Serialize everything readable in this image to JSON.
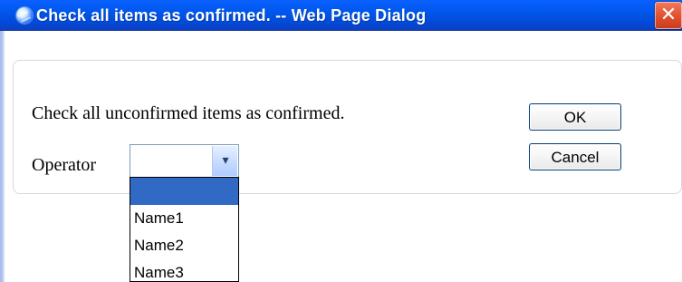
{
  "window": {
    "title": "Check all items as confirmed. -- Web Page Dialog",
    "close_glyph": "✕"
  },
  "content": {
    "message": "Check all unconfirmed items as confirmed.",
    "operator_label": "Operator",
    "ok_label": "OK",
    "cancel_label": "Cancel"
  },
  "operator_select": {
    "selected_value": "",
    "options": [
      "",
      "Name1",
      "Name2",
      "Name3"
    ]
  },
  "icons": {
    "app_icon": "ie-dialog-icon",
    "close_icon": "close-icon",
    "dropdown_icon": "chevron-down-icon"
  }
}
